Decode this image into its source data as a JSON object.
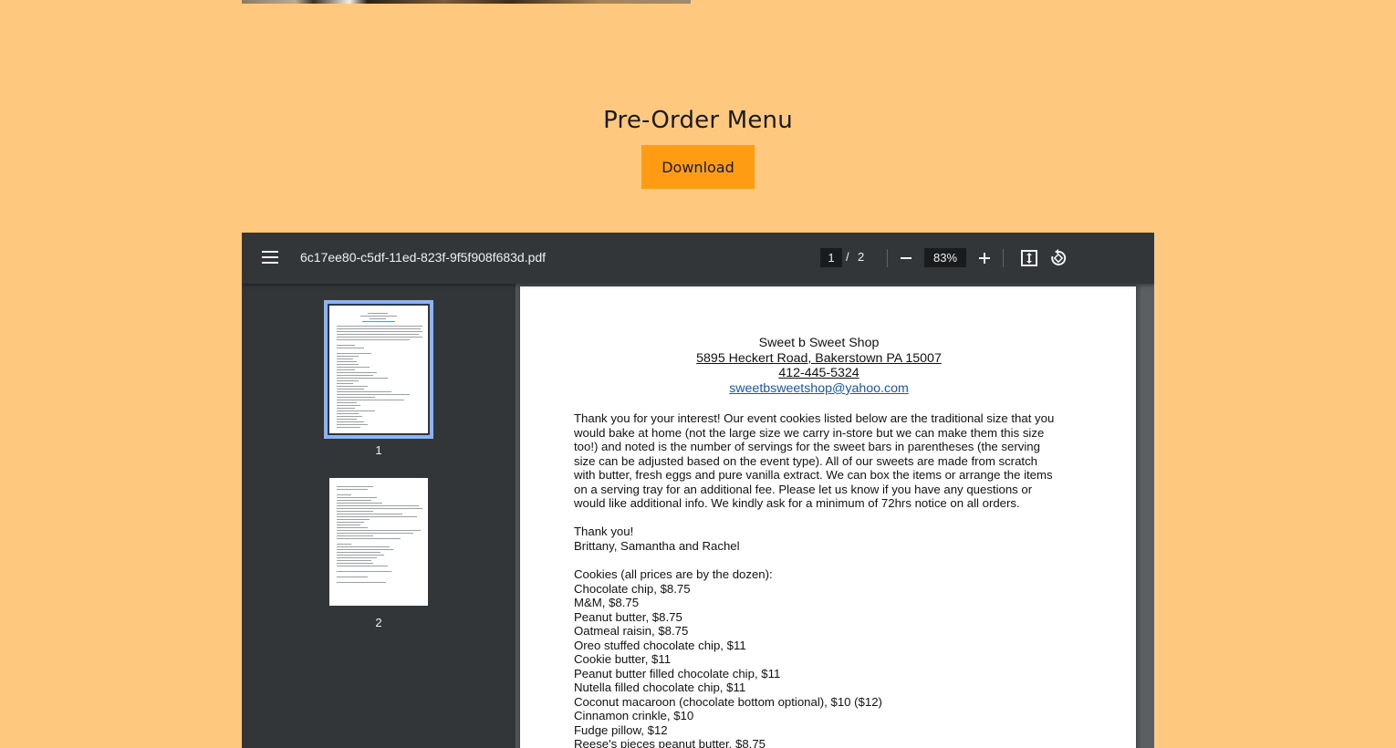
{
  "page": {
    "heading": "Pre-Order Menu",
    "download_label": "Download"
  },
  "viewer": {
    "file_name": "6c17ee80-c5df-11ed-823f-9f5f908f683d.pdf",
    "current_page": "1",
    "page_separator": "/",
    "total_pages": "2",
    "zoom": "83%",
    "thumbnails": [
      {
        "label": "1",
        "selected": true
      },
      {
        "label": "2",
        "selected": false
      }
    ]
  },
  "document": {
    "shop_name": "Sweet b Sweet Shop",
    "address": "5895 Heckert Road, Bakerstown PA 15007",
    "phone": "412-445-5324",
    "email": "sweetbsweetshop@yahoo.com",
    "intro_lines": [
      "Thank you for your interest! Our event cookies listed below are the traditional size that you",
      "would bake at home (not the large size we carry in-store but we can make them this size",
      "too!) and noted is the number of servings for the sweet bars in parentheses (the serving",
      "size can be adjusted based on the event type).  All of our sweets are made from scratch",
      "with butter, fresh eggs and pure vanilla extract.  We can box the items or arrange the items",
      "on a serving tray for an additional fee. Please let us know if you have any questions or",
      "would like additional info. We kindly ask for a minimum of 72hrs notice on all orders."
    ],
    "thanks": "Thank you!",
    "signature": "Brittany, Samantha and Rachel",
    "cookies_heading": "Cookies (all prices are by the dozen):",
    "cookies": [
      "Chocolate chip, $8.75",
      "M&M, $8.75",
      "Peanut butter, $8.75",
      "Oatmeal raisin, $8.75",
      "Oreo stuffed chocolate chip, $11",
      "Cookie butter, $11",
      "Peanut butter filled chocolate chip, $11",
      "Nutella filled chocolate chip, $11",
      "Coconut macaroon (chocolate bottom optional), $10 ($12)",
      "Cinnamon crinkle, $10",
      "Fudge pillow, $12",
      "Reese's pieces peanut butter, $8.75"
    ]
  },
  "colors": {
    "background": "#ffc87f",
    "button": "#ff9c14",
    "toolbar": "#323639",
    "viewer": "#525659",
    "thumb_selected": "#8ab4f8",
    "email_link": "#1155cc"
  }
}
